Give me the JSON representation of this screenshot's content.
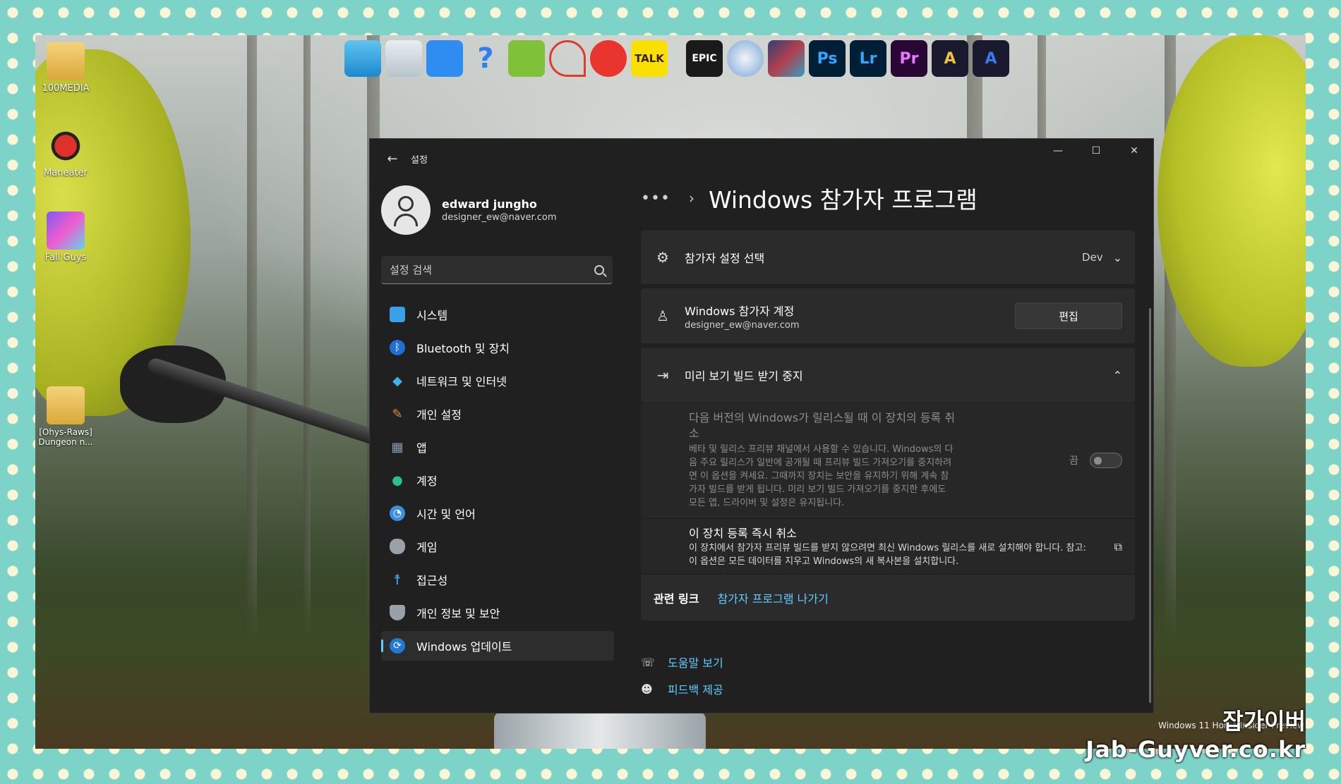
{
  "desktop": {
    "icons": [
      {
        "label": "100MEDIA",
        "icon": "folder-icon"
      },
      {
        "label": "Maneater",
        "icon": "maneater-icon"
      },
      {
        "label": "Fall Guys",
        "icon": "fallguys-icon"
      },
      {
        "label": "[Ohys-Raws] Dungeon n...",
        "icon": "folder-icon"
      }
    ],
    "taskbar_icons": [
      {
        "name": "monitor-icon",
        "label": ""
      },
      {
        "name": "recycle-bin-icon",
        "label": ""
      },
      {
        "name": "virtualbox-icon",
        "label": ""
      },
      {
        "name": "help-icon",
        "label": "?"
      },
      {
        "name": "search-app-icon",
        "label": ""
      },
      {
        "name": "curve-icon",
        "label": ""
      },
      {
        "name": "record-icon",
        "label": ""
      },
      {
        "name": "kakaotalk-icon",
        "label": "TALK"
      },
      {
        "name": "epic-games-icon",
        "label": "EPIC"
      },
      {
        "name": "browser-icon",
        "label": ""
      },
      {
        "name": "game-icon",
        "label": ""
      },
      {
        "name": "photoshop-icon",
        "label": "Ps"
      },
      {
        "name": "lightroom-icon",
        "label": "Lr"
      },
      {
        "name": "premiere-icon",
        "label": "Pr"
      },
      {
        "name": "affinity-icon",
        "label": "A"
      },
      {
        "name": "affinity-designer-icon",
        "label": "A"
      }
    ]
  },
  "window": {
    "app_title": "설정",
    "controls": {
      "minimize": "—",
      "maximize": "☐",
      "close": "✕"
    }
  },
  "profile": {
    "name": "edward jungho",
    "email": "designer_ew@naver.com"
  },
  "search": {
    "placeholder": "설정 검색"
  },
  "nav": [
    {
      "label": "시스템",
      "icon": "system-icon",
      "color": "#3aa0e8"
    },
    {
      "label": "Bluetooth 및 장치",
      "icon": "bluetooth-icon",
      "color": "#1f6fd6"
    },
    {
      "label": "네트워크 및 인터넷",
      "icon": "wifi-icon",
      "color": "#3fb1f0"
    },
    {
      "label": "개인 설정",
      "icon": "brush-icon",
      "color": "#e88a3a"
    },
    {
      "label": "앱",
      "icon": "apps-icon",
      "color": "#8a9bb0"
    },
    {
      "label": "계정",
      "icon": "account-icon",
      "color": "#2dbf8a"
    },
    {
      "label": "시간 및 언어",
      "icon": "clock-globe-icon",
      "color": "#3a8fe0"
    },
    {
      "label": "게임",
      "icon": "gamepad-icon",
      "color": "#9aa0a8"
    },
    {
      "label": "접근성",
      "icon": "accessibility-icon",
      "color": "#3aa8f0"
    },
    {
      "label": "개인 정보 및 보안",
      "icon": "shield-icon",
      "color": "#9aa0a8"
    },
    {
      "label": "Windows 업데이트",
      "icon": "update-icon",
      "color": "#1f7ad6",
      "active": true
    }
  ],
  "main": {
    "breadcrumb_more": "•••",
    "breadcrumb_sep": "›",
    "title": "Windows 참가자 프로그램",
    "channel": {
      "label": "참가자 설정 선택",
      "value": "Dev"
    },
    "account": {
      "title": "Windows 참가자 계정",
      "email": "designer_ew@naver.com",
      "button": "편집"
    },
    "stop_builds": {
      "title": "미리 보기 빌드 받기 중지",
      "unenroll_next": {
        "title": "다음 버전의 Windows가 릴리스될 때 이 장치의 등록 취소",
        "desc": "베타 및 릴리스 프리뷰 채널에서 사용할 수 있습니다. Windows의 다음 주요 릴리스가 일반에 공개될 때 프리뷰 빌드 가져오기를 중지하려면 이 옵션을 켜세요. 그때까지 장치는 보안을 유지하기 위해 계속 참가자 빌드를 받게 됩니다. 미리 보기 빌드 가져오기를 중지한 후에도 모든 앱, 드라이버 및 설정은 유지됩니다.",
        "toggle_label": "끔"
      },
      "unenroll_now": {
        "title": "이 장치 등록 즉시 취소",
        "desc": "이 장치에서 참가자 프리뷰 빌드를 받지 않으려면 최신 Windows 릴리스를 새로 설치해야 합니다. 참고: 이 옵션은 모든 데이터를 지우고 Windows의 새 복사본을 설치합니다."
      }
    },
    "related": {
      "label": "관련 링크",
      "link": "참가자 프로그램 나가기"
    },
    "help": {
      "get_help": "도움말 보기",
      "feedback": "피드백 제공"
    }
  },
  "watermark": {
    "brand_ko": "잡가이버",
    "brand_en": "Jab-Guyver.co.kr",
    "build": "Windows 11 Home Insider Preview"
  }
}
